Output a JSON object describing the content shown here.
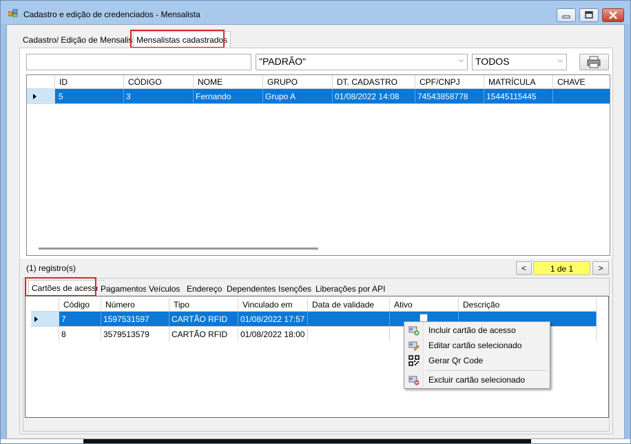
{
  "window": {
    "title": "Cadastro e edição de credenciados - Mensalista",
    "buttons": [
      "minimize-icon",
      "maximize-icon",
      "close-icon"
    ]
  },
  "main_tabs": [
    {
      "label": "Cadastro/ Edição de Mensalista",
      "active": false
    },
    {
      "label": "Mensalistas cadastrados",
      "active": true
    }
  ],
  "filters": {
    "search_value": "",
    "group_select": "\"PADRÃO\"",
    "status_select": "TODOS",
    "print_icon": "printer-icon"
  },
  "top_grid": {
    "columns": [
      "ID",
      "CÓDIGO",
      "NOME",
      "GRUPO",
      "DT. CADASTRO",
      "CPF/CNPJ",
      "MATRÍCULA",
      "CHAVE"
    ],
    "rows": [
      [
        "5",
        "3",
        "Fernando",
        "Grupo A",
        "01/08/2022 14:08",
        "74543858778",
        "15445115445",
        ""
      ]
    ]
  },
  "pagination": {
    "record_count": "(1) registro(s)",
    "page_label": "1 de 1",
    "prev": "<",
    "next": ">"
  },
  "sub_tabs": [
    {
      "label": "Cartões de acesso",
      "active": true
    },
    {
      "label": "Pagamentos",
      "active": false
    },
    {
      "label": "Veículos",
      "active": false
    },
    {
      "label": "Endereço",
      "active": false
    },
    {
      "label": "Dependentes",
      "active": false
    },
    {
      "label": "Isenções",
      "active": false
    },
    {
      "label": "Liberações por API",
      "active": false
    }
  ],
  "cards_grid": {
    "columns": [
      "Código",
      "Número",
      "Tipo",
      "Vinculado em",
      "Data de validade",
      "Ativo",
      "Descrição"
    ],
    "rows": [
      [
        "7",
        "1597531597",
        "CARTÃO RFID",
        "01/08/2022 17:57",
        "",
        "",
        ""
      ],
      [
        "8",
        "3579513579",
        "CARTÃO RFID",
        "01/08/2022 18:00",
        "",
        "",
        ""
      ]
    ]
  },
  "context_menu": {
    "items": [
      {
        "label": "Incluir cartão de acesso",
        "icon": "add-card-icon"
      },
      {
        "label": "Editar cartão selecionado",
        "icon": "edit-card-icon"
      },
      {
        "label": "Gerar Qr Code",
        "icon": "qr-code-icon"
      },
      {
        "label": "Excluir cartão selecionado",
        "icon": "delete-card-icon"
      }
    ]
  }
}
